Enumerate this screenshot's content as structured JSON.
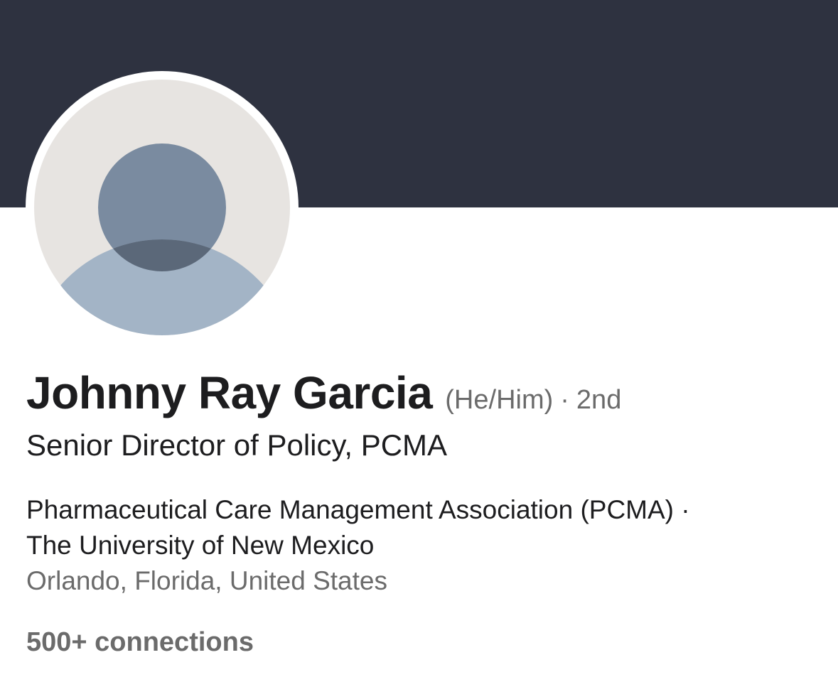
{
  "profile": {
    "name": "Johnny Ray Garcia",
    "pronouns": "(He/Him)",
    "separator": "·",
    "degree": "2nd",
    "headline": "Senior Director of Policy, PCMA",
    "company_line_1": "Pharmaceutical Care Management Association (PCMA) ·",
    "company_line_2": "The University of New Mexico",
    "location": "Orlando, Florida, United States",
    "connections": "500+ connections"
  },
  "colors": {
    "banner": "#2e3240",
    "avatar_bg": "#e7e4e1",
    "avatar_head": "#7a8ba0",
    "avatar_body": "#a3b4c6",
    "avatar_overlap": "#5b6879",
    "text_primary": "#1d1d1f",
    "text_secondary": "#6b6b6b"
  },
  "icons": {
    "avatar": "default-person-silhouette-icon"
  }
}
